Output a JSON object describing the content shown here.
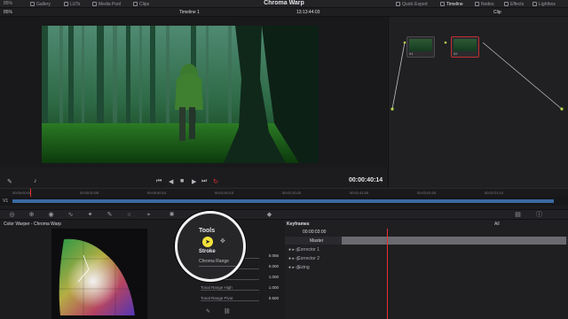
{
  "topbar": {
    "zoom": "85%",
    "left_items": [
      "Gallery",
      "LUTs",
      "Media Pool",
      "Clips"
    ],
    "title": "Chroma Warp",
    "right_items": [
      "Quick Export",
      "Timeline",
      "Nodes",
      "Effects",
      "Lightbox"
    ]
  },
  "viewer": {
    "timeline_name": "Timeline 1",
    "timecode_top": "13:13:44:03",
    "clip_label": "Clip",
    "timecode": "00:00:40:14"
  },
  "nodes": [
    {
      "label": "01"
    },
    {
      "label": "02"
    }
  ],
  "ruler": {
    "ticks": [
      "00:00:00:00",
      "00:00:20:05",
      "00:00:40:10",
      "00:01:00:15",
      "00:01:20:20",
      "00:01:41:00",
      "00:02:01:05",
      "00:02:21:10"
    ]
  },
  "track": {
    "label": "V1"
  },
  "colorwarper": {
    "title": "Color Warper - Chroma Warp"
  },
  "tools": {
    "title": "Tools",
    "stroke": "Stroke",
    "range": "Chroma Range",
    "props": [
      {
        "label": "Exposure",
        "value": "0.056"
      },
      {
        "label": "",
        "value": "0.000"
      },
      {
        "label": "",
        "value": "1.000"
      },
      {
        "label": "Tonal Range High",
        "value": "1.000"
      },
      {
        "label": "Tonal Range Pivot",
        "value": "0.500"
      }
    ]
  },
  "keyframes": {
    "title": "Keyframes",
    "filter": "All",
    "time": "00:00:03:00",
    "rows": [
      "Master",
      "Corrector 1",
      "Corrector 2",
      "Sizing"
    ]
  },
  "colors": {
    "accent": "#e53030",
    "highlight": "#f2e23a"
  }
}
